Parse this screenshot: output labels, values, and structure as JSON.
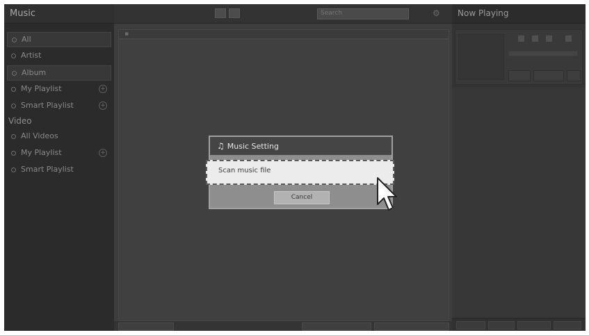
{
  "sidebar": {
    "title": "Music",
    "items": [
      {
        "label": "All"
      },
      {
        "label": "Artist"
      },
      {
        "label": "Album"
      },
      {
        "label": "My Playlist"
      },
      {
        "label": "Smart Playlist"
      }
    ],
    "video_group": "Video",
    "video_items": [
      {
        "label": "All Videos"
      },
      {
        "label": "My Playlist"
      },
      {
        "label": "Smart Playlist"
      }
    ]
  },
  "toolbar": {
    "search_placeholder": "Search"
  },
  "right_panel": {
    "title": "Now Playing"
  },
  "dialog": {
    "title": "Music Setting",
    "option": "Scan music file",
    "cancel": "Cancel"
  }
}
